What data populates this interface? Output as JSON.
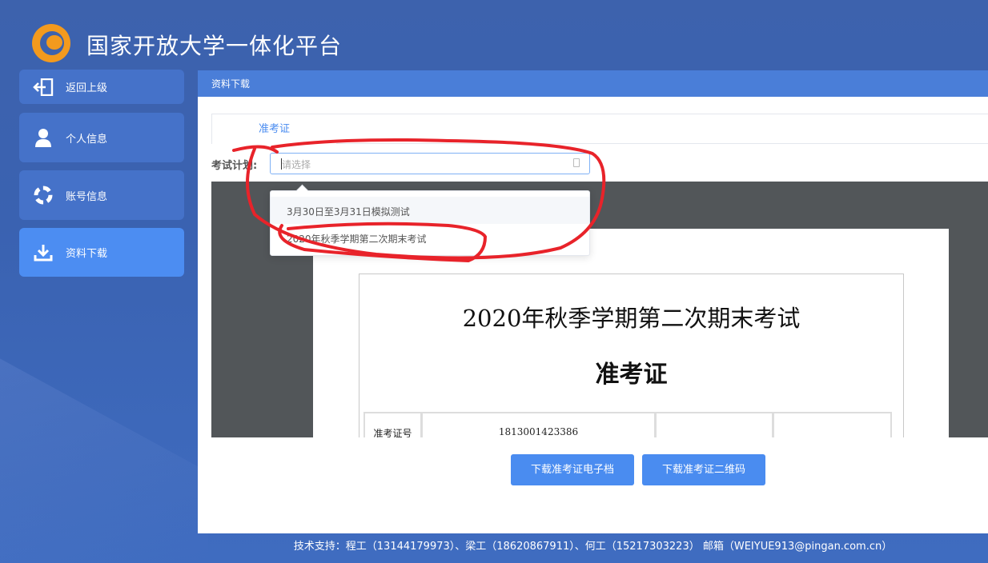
{
  "header": {
    "title": "国家开放大学一体化平台"
  },
  "sidebar": {
    "items": [
      {
        "label": "返回上级",
        "icon": "back-arrow-icon"
      },
      {
        "label": "个人信息",
        "icon": "user-icon"
      },
      {
        "label": "账号信息",
        "icon": "lifebuoy-icon"
      },
      {
        "label": "资料下载",
        "icon": "download-icon",
        "active": true
      }
    ]
  },
  "panel": {
    "heading": "资料下载",
    "tabs": [
      {
        "label": "准考证",
        "active": true
      }
    ],
    "exam_plan": {
      "label": "考试计划:",
      "placeholder": "请选择",
      "options": [
        "3月30日至3月31日模拟测试",
        "2020年秋季学期第二次期末考试"
      ]
    },
    "preview": {
      "doc_title": "2020年秋季学期第二次期末考试",
      "doc_subtitle": "准考证",
      "row_label": "准考证号",
      "row_value": "1813001423386"
    },
    "buttons": {
      "download_doc": "下载准考证电子档",
      "download_qr": "下载准考证二维码"
    }
  },
  "footer": {
    "text": "技术支持：程工（13144179973）、梁工（18620867911）、何工（15217303223） 邮箱（WEIYUE913@pingan.com.cn）"
  },
  "colors": {
    "background": "#3d62ad",
    "sidebar_item": "#4572c9",
    "sidebar_active": "#4c8df2",
    "primary": "#4a8cf0",
    "logo": "#f39a1e",
    "annotation": "#e8232a"
  }
}
